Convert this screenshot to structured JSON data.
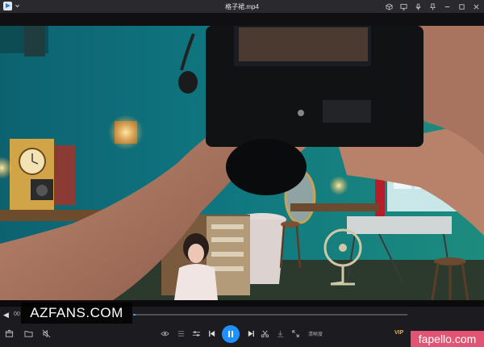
{
  "window": {
    "title": "格子裙.mp4"
  },
  "playback": {
    "time": "00",
    "progress_fraction": 0.01
  },
  "controls": {
    "quality_label": "清晰度",
    "vip_label": "VIP"
  },
  "watermarks": {
    "left": "AZFANS.COM",
    "right": "fapello.com"
  },
  "colors": {
    "accent": "#1e90ff",
    "watermark_pink": "#e35373"
  }
}
